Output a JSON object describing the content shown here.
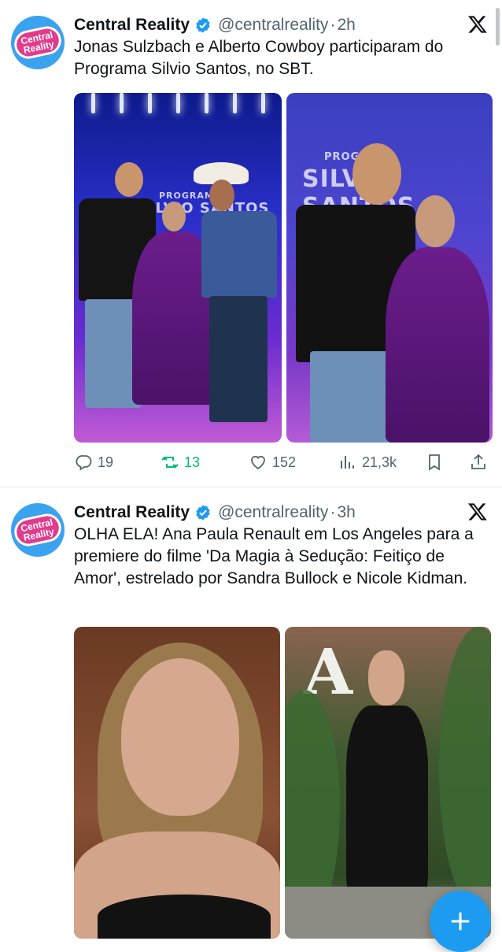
{
  "tweets": [
    {
      "author": "Central Reality",
      "handle": "@centralreality",
      "separator": "·",
      "time": "2h",
      "avatar_text_1": "Central",
      "avatar_text_2": "Reality",
      "text": "Jonas Sulzbach e Alberto Cowboy participaram do Programa Silvio Santos, no SBT.",
      "image_left_sign_1": "PROGRAMA",
      "image_left_sign_2": "SILVIO SANTOS",
      "image_right_sign_1": "PROGRAMA",
      "image_right_sign_2": "SILVIO SANTOS",
      "actions": {
        "replies": "19",
        "retweets": "13",
        "likes": "152",
        "views": "21,3k"
      }
    },
    {
      "author": "Central Reality",
      "handle": "@centralreality",
      "separator": "·",
      "time": "3h",
      "avatar_text_1": "Central",
      "avatar_text_2": "Reality",
      "text": "OLHA ELA! Ana Paula Renault em Los Angeles para a premiere do filme 'Da Magia à Sedução: Feitiço de Amor', estrelado por Sandra Bullock e Nicole Kidman."
    }
  ],
  "colors": {
    "accent": "#1d9bf0",
    "retweet": "#00ba7c",
    "secondary_text": "#536471",
    "avatar_bg": "#3aa3f0",
    "avatar_pill": "#e23b8e"
  },
  "icons": [
    "verified-badge-icon",
    "x-logo-icon",
    "reply-icon",
    "retweet-icon",
    "like-icon",
    "views-icon",
    "bookmark-icon",
    "share-icon",
    "compose-plus-icon"
  ]
}
